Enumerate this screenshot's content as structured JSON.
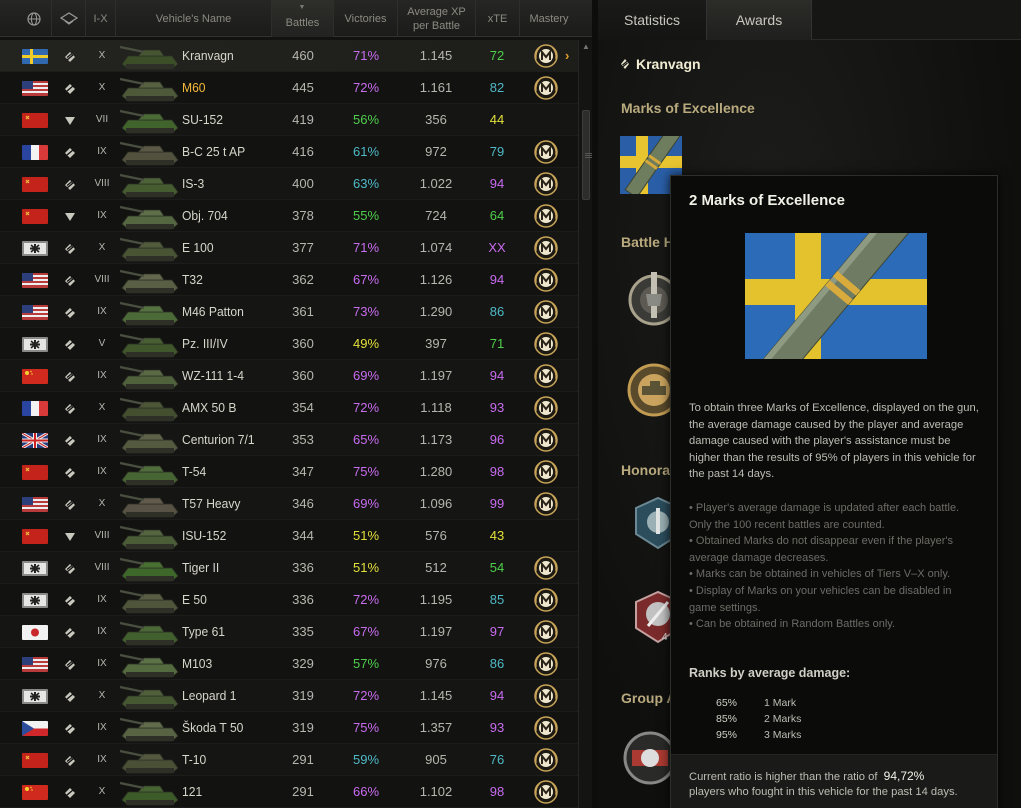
{
  "header": {
    "nation_icon": "globe-icon",
    "type_icon": "tank-class-icon",
    "tier_label": "I-X",
    "name_label": "Vehicle's Name",
    "battles_label": "Battles",
    "victories_label": "Victories",
    "xp_label_1": "Average XP",
    "xp_label_2": "per Battle",
    "xte_label": "xTE",
    "mastery_label": "Mastery"
  },
  "rows": [
    {
      "flag": "sweden",
      "type": "heavy",
      "tier": "X",
      "name": "Kranvagn",
      "battles": "460",
      "victories": "71%",
      "vic_color": "#c86cf0",
      "xp": "1.145",
      "xte": "72",
      "xte_color": "#4fcf4c",
      "mastery": true,
      "selected": true,
      "gold": false
    },
    {
      "flag": "usa",
      "type": "medium",
      "tier": "X",
      "name": "M60",
      "battles": "445",
      "victories": "72%",
      "vic_color": "#c86cf0",
      "xp": "1.161",
      "xte": "82",
      "xte_color": "#4fb9c8",
      "mastery": true,
      "selected": false,
      "gold": true
    },
    {
      "flag": "ussr",
      "type": "td",
      "tier": "VII",
      "name": "SU-152",
      "battles": "419",
      "victories": "56%",
      "vic_color": "#4fcf4c",
      "xp": "356",
      "xte": "44",
      "xte_color": "#e3e03a",
      "mastery": false,
      "selected": false,
      "gold": false
    },
    {
      "flag": "france",
      "type": "medium",
      "tier": "IX",
      "name": "B-C 25 t AP",
      "battles": "416",
      "victories": "61%",
      "vic_color": "#4fb9c8",
      "xp": "972",
      "xte": "79",
      "xte_color": "#4fb9c8",
      "mastery": true,
      "selected": false,
      "gold": false
    },
    {
      "flag": "ussr",
      "type": "heavy",
      "tier": "VIII",
      "name": "IS-3",
      "battles": "400",
      "victories": "63%",
      "vic_color": "#4fb9c8",
      "xp": "1.022",
      "xte": "94",
      "xte_color": "#c86cf0",
      "mastery": true,
      "selected": false,
      "gold": false
    },
    {
      "flag": "ussr",
      "type": "td",
      "tier": "IX",
      "name": "Obj. 704",
      "battles": "378",
      "victories": "55%",
      "vic_color": "#4fcf4c",
      "xp": "724",
      "xte": "64",
      "xte_color": "#4fcf4c",
      "mastery": true,
      "selected": false,
      "gold": false
    },
    {
      "flag": "germany",
      "type": "heavy",
      "tier": "X",
      "name": "E 100",
      "battles": "377",
      "victories": "71%",
      "vic_color": "#c86cf0",
      "xp": "1.074",
      "xte": "XX",
      "xte_color": "#c86cf0",
      "mastery": true,
      "selected": false,
      "gold": false
    },
    {
      "flag": "usa",
      "type": "heavy",
      "tier": "VIII",
      "name": "T32",
      "battles": "362",
      "victories": "67%",
      "vic_color": "#c86cf0",
      "xp": "1.126",
      "xte": "94",
      "xte_color": "#c86cf0",
      "mastery": true,
      "selected": false,
      "gold": false
    },
    {
      "flag": "usa",
      "type": "medium",
      "tier": "IX",
      "name": "M46 Patton",
      "battles": "361",
      "victories": "73%",
      "vic_color": "#c86cf0",
      "xp": "1.290",
      "xte": "86",
      "xte_color": "#4fb9c8",
      "mastery": true,
      "selected": false,
      "gold": false
    },
    {
      "flag": "germany",
      "type": "medium",
      "tier": "V",
      "name": "Pz. III/IV",
      "battles": "360",
      "victories": "49%",
      "vic_color": "#e3e03a",
      "xp": "397",
      "xte": "71",
      "xte_color": "#4fcf4c",
      "mastery": true,
      "selected": false,
      "gold": false
    },
    {
      "flag": "china",
      "type": "heavy",
      "tier": "IX",
      "name": "WZ-111 1-4",
      "battles": "360",
      "victories": "69%",
      "vic_color": "#c86cf0",
      "xp": "1.197",
      "xte": "94",
      "xte_color": "#c86cf0",
      "mastery": true,
      "selected": false,
      "gold": false
    },
    {
      "flag": "france",
      "type": "heavy",
      "tier": "X",
      "name": "AMX 50 B",
      "battles": "354",
      "victories": "72%",
      "vic_color": "#c86cf0",
      "xp": "1.118",
      "xte": "93",
      "xte_color": "#c86cf0",
      "mastery": true,
      "selected": false,
      "gold": false
    },
    {
      "flag": "uk",
      "type": "medium",
      "tier": "IX",
      "name": "Centurion 7/1",
      "battles": "353",
      "victories": "65%",
      "vic_color": "#c86cf0",
      "xp": "1.173",
      "xte": "96",
      "xte_color": "#c86cf0",
      "mastery": true,
      "selected": false,
      "gold": false
    },
    {
      "flag": "ussr",
      "type": "medium",
      "tier": "IX",
      "name": "T-54",
      "battles": "347",
      "victories": "75%",
      "vic_color": "#c86cf0",
      "xp": "1.280",
      "xte": "98",
      "xte_color": "#c86cf0",
      "mastery": true,
      "selected": false,
      "gold": false
    },
    {
      "flag": "usa",
      "type": "heavy",
      "tier": "X",
      "name": "T57 Heavy",
      "battles": "346",
      "victories": "69%",
      "vic_color": "#c86cf0",
      "xp": "1.096",
      "xte": "99",
      "xte_color": "#c86cf0",
      "mastery": true,
      "selected": false,
      "gold": false
    },
    {
      "flag": "ussr",
      "type": "td",
      "tier": "VIII",
      "name": "ISU-152",
      "battles": "344",
      "victories": "51%",
      "vic_color": "#e3e03a",
      "xp": "576",
      "xte": "43",
      "xte_color": "#e3e03a",
      "mastery": false,
      "selected": false,
      "gold": false
    },
    {
      "flag": "germany",
      "type": "heavy",
      "tier": "VIII",
      "name": "Tiger II",
      "battles": "336",
      "victories": "51%",
      "vic_color": "#e3e03a",
      "xp": "512",
      "xte": "54",
      "xte_color": "#4fcf4c",
      "mastery": true,
      "selected": false,
      "gold": false
    },
    {
      "flag": "germany",
      "type": "medium",
      "tier": "IX",
      "name": "E 50",
      "battles": "336",
      "victories": "72%",
      "vic_color": "#c86cf0",
      "xp": "1.195",
      "xte": "85",
      "xte_color": "#4fb9c8",
      "mastery": true,
      "selected": false,
      "gold": false
    },
    {
      "flag": "japan",
      "type": "medium",
      "tier": "IX",
      "name": "Type 61",
      "battles": "335",
      "victories": "67%",
      "vic_color": "#c86cf0",
      "xp": "1.197",
      "xte": "97",
      "xte_color": "#c86cf0",
      "mastery": true,
      "selected": false,
      "gold": false
    },
    {
      "flag": "usa",
      "type": "heavy",
      "tier": "IX",
      "name": "M103",
      "battles": "329",
      "victories": "57%",
      "vic_color": "#4fcf4c",
      "xp": "976",
      "xte": "86",
      "xte_color": "#4fb9c8",
      "mastery": true,
      "selected": false,
      "gold": false
    },
    {
      "flag": "germany",
      "type": "medium",
      "tier": "X",
      "name": "Leopard 1",
      "battles": "319",
      "victories": "72%",
      "vic_color": "#c86cf0",
      "xp": "1.145",
      "xte": "94",
      "xte_color": "#c86cf0",
      "mastery": true,
      "selected": false,
      "gold": false
    },
    {
      "flag": "czech",
      "type": "medium",
      "tier": "IX",
      "name": "Škoda T 50",
      "battles": "319",
      "victories": "75%",
      "vic_color": "#c86cf0",
      "xp": "1.357",
      "xte": "93",
      "xte_color": "#c86cf0",
      "mastery": true,
      "selected": false,
      "gold": false
    },
    {
      "flag": "ussr",
      "type": "heavy",
      "tier": "IX",
      "name": "T-10",
      "battles": "291",
      "victories": "59%",
      "vic_color": "#4fb9c8",
      "xp": "905",
      "xte": "76",
      "xte_color": "#4fb9c8",
      "mastery": true,
      "selected": false,
      "gold": false
    },
    {
      "flag": "china",
      "type": "medium",
      "tier": "X",
      "name": "121",
      "battles": "291",
      "victories": "66%",
      "vic_color": "#c86cf0",
      "xp": "1.102",
      "xte": "98",
      "xte_color": "#c86cf0",
      "mastery": true,
      "selected": false,
      "gold": false
    }
  ],
  "tabs": {
    "statistics": "Statistics",
    "awards": "Awards"
  },
  "vehicle": {
    "name": "Kranvagn"
  },
  "sections": {
    "marks": "Marks of Excellence",
    "battle_heroes": "Battle H",
    "honorary": "Honorar",
    "group": "Group A"
  },
  "tooltip": {
    "title": "2 Marks of Excellence",
    "description": "To obtain three Marks of Excellence, displayed on the gun, the average damage caused by the player and average damage caused with the player's assistance must be higher than the results of 95% of players in this vehicle for the past 14 days.",
    "notes": [
      "• Player's average damage is updated after each battle. Only the 100 recent battles are counted.",
      "• Obtained Marks do not disappear even if the player's average damage decreases.",
      "• Marks can be obtained in vehicles of Tiers V–X only.",
      "• Display of Marks on your vehicles can be disabled in game settings.",
      "• Can be obtained in Random Battles only."
    ],
    "ranks_heading": "Ranks by average damage:",
    "ranks": [
      {
        "pct": "65%",
        "label": "1 Mark"
      },
      {
        "pct": "85%",
        "label": "2 Marks"
      },
      {
        "pct": "95%",
        "label": "3 Marks"
      }
    ],
    "footer_line1": "Current ratio is higher than the ratio of",
    "footer_value": "94,72%",
    "footer_line2": "players who fought in this vehicle for the past 14 days."
  },
  "award_badge_count": "4",
  "colors": {
    "accent_gold": "#f5b93b",
    "section_gold": "#b9aa7e",
    "unicum_purple": "#c86cf0",
    "good_cyan": "#4fb9c8",
    "green": "#4fcf4c",
    "yellow": "#e3e03a"
  }
}
